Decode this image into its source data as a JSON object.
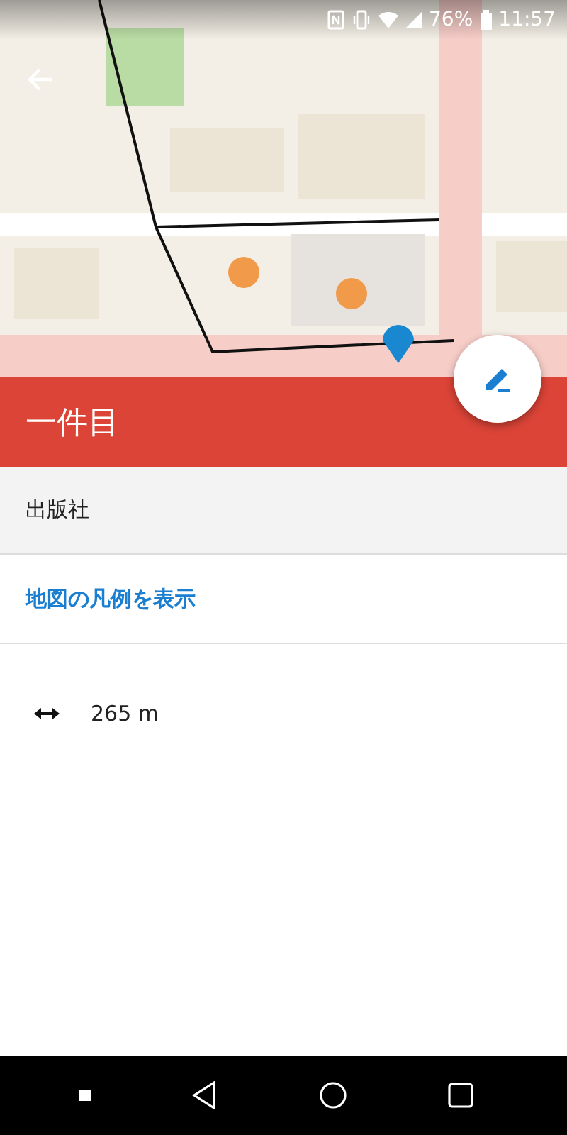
{
  "status_bar": {
    "battery": "76%",
    "time": "11:57"
  },
  "header": {
    "title": "一件目"
  },
  "category": "出版社",
  "legend_link": "地図の凡例を表示",
  "distance": "265 m"
}
